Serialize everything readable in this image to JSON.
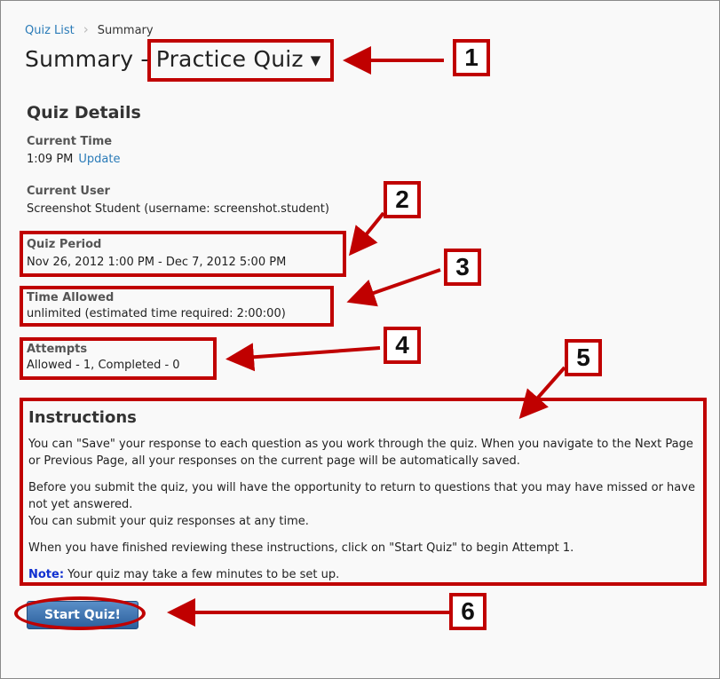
{
  "breadcrumb": {
    "quiz_list": "Quiz List",
    "current": "Summary"
  },
  "page_title": {
    "prefix": "Summary - ",
    "quiz_name": "Practice Quiz"
  },
  "quiz_details": {
    "heading": "Quiz Details",
    "current_time": {
      "label": "Current Time",
      "value": "1:09 PM",
      "update_link": "Update"
    },
    "current_user": {
      "label": "Current User",
      "value": "Screenshot Student (username: screenshot.student)"
    },
    "quiz_period": {
      "label": "Quiz Period",
      "value": "Nov 26, 2012 1:00 PM - Dec 7, 2012 5:00 PM"
    },
    "time_allowed": {
      "label": "Time Allowed",
      "value": "unlimited (estimated time required: 2:00:00)"
    },
    "attempts": {
      "label": "Attempts",
      "value": "Allowed - 1, Completed - 0"
    }
  },
  "instructions": {
    "heading": "Instructions",
    "p1": "You can \"Save\" your response to each question as you work through the quiz. When you navigate to the Next Page or Previous Page, all your responses on the current page will be automatically saved.",
    "p2a": "Before you submit the quiz, you will have the opportunity to return to questions that you may have missed or have not yet answered.",
    "p2b": "You can submit your quiz responses at any time.",
    "p3": "When you have finished reviewing these instructions, click on \"Start Quiz\" to begin Attempt 1.",
    "note_label": "Note:",
    "note_text": " Your quiz may take a few minutes to be set up."
  },
  "start_button": "Start Quiz!",
  "callouts": [
    "1",
    "2",
    "3",
    "4",
    "5",
    "6"
  ],
  "colors": {
    "annotation": "#c00000",
    "link": "#2a7bb8",
    "button": "#2c5f9c"
  }
}
